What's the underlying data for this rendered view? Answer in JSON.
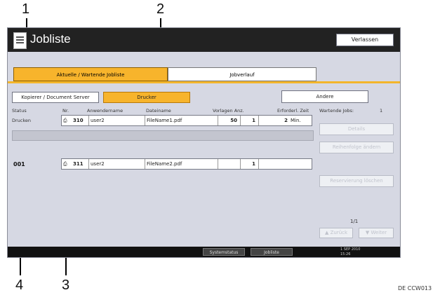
{
  "callouts": [
    "1",
    "2",
    "3",
    "4"
  ],
  "footer_code": "DE CCW013",
  "window": {
    "title": "Jobliste",
    "exit_label": "Verlassen"
  },
  "tabs": {
    "active": "Aktuelle / Wartende Jobliste",
    "history": "Jobverlauf"
  },
  "filters": {
    "copier": "Kopierer / Document Server",
    "printer": "Drucker",
    "other": "Andere"
  },
  "columns": {
    "status": "Status",
    "no": "Nr.",
    "user": "Anwendername",
    "file": "Dateiname",
    "copies": "Vorlagen Anz.",
    "sets": "",
    "time": "Erforderl. Zeit",
    "waiting": "Wartende Jobs:",
    "waiting_count": "1"
  },
  "jobs": [
    {
      "status": "Drucken",
      "no": "310",
      "user": "user2",
      "file": "FileName1.pdf",
      "pages": "50",
      "sets": "1",
      "time": "2",
      "time_unit": "Min."
    },
    {
      "status": "001",
      "no": "311",
      "user": "user2",
      "file": "FileName2.pdf",
      "pages": "",
      "sets": "1",
      "time": "",
      "time_unit": ""
    }
  ],
  "side": {
    "details": "Details",
    "change_order": "Reihenfolge ändern",
    "delete_reservation": "Reservierung löschen",
    "page": "1/1",
    "prev": "Zurück",
    "next": "Weiter"
  },
  "statusbar": {
    "system_status": "Systemstatus",
    "job_list": "Jobliste",
    "date": "1 SEP 2010",
    "time": "15:26"
  }
}
